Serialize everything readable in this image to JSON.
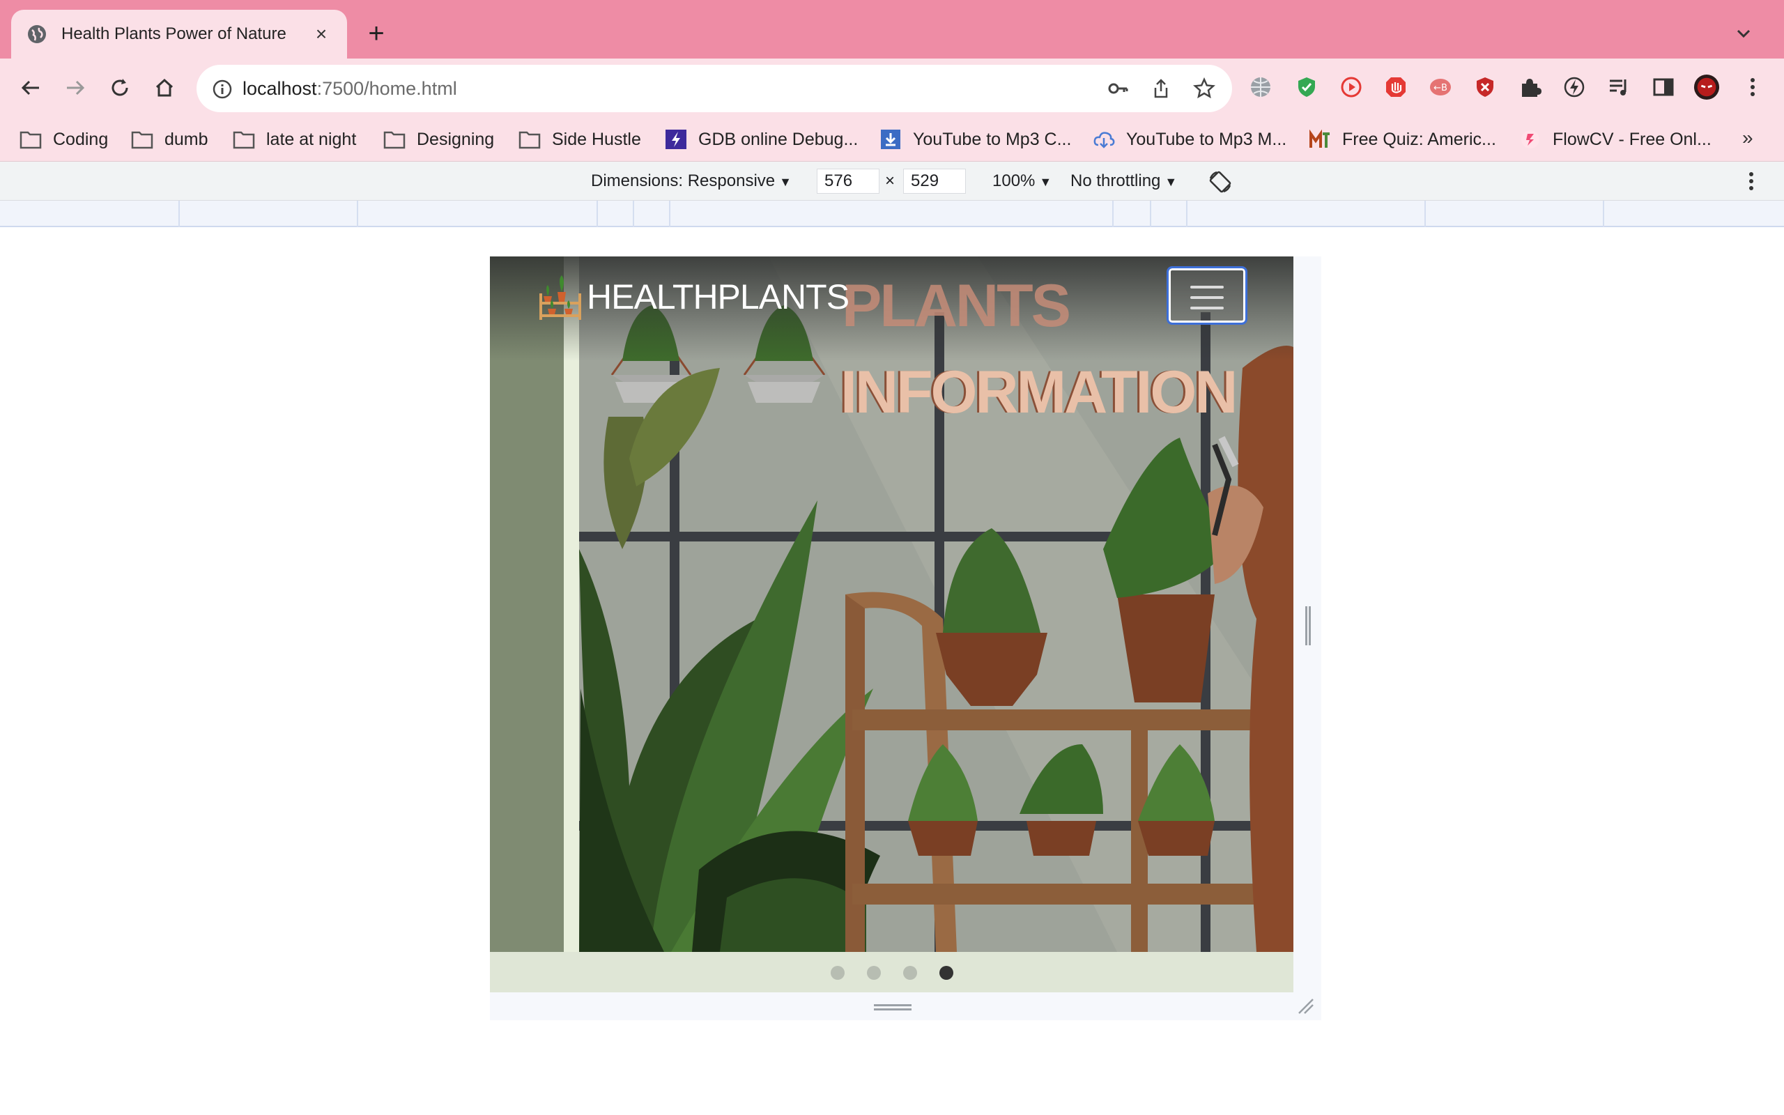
{
  "browser": {
    "tab": {
      "title": "Health Plants Power of Nature",
      "close_label": "×"
    },
    "new_tab_label": "+",
    "url": {
      "host": "localhost",
      "rest": ":7500/home.html"
    }
  },
  "bookmarks": [
    {
      "label": "Coding",
      "icon": "folder-icon"
    },
    {
      "label": "dumb",
      "icon": "folder-icon"
    },
    {
      "label": "late at night",
      "icon": "folder-icon"
    },
    {
      "label": "Designing",
      "icon": "folder-icon"
    },
    {
      "label": "Side Hustle",
      "icon": "folder-icon"
    },
    {
      "label": "GDB online Debug...",
      "icon": "gdb-icon"
    },
    {
      "label": "YouTube to Mp3 C...",
      "icon": "download-icon"
    },
    {
      "label": "YouTube to Mp3 M...",
      "icon": "cloud-download-icon"
    },
    {
      "label": "Free Quiz: Americ...",
      "icon": "quiz-icon"
    },
    {
      "label": "FlowCV - Free Onl...",
      "icon": "flowcv-icon"
    }
  ],
  "devtools": {
    "dimensions_label": "Dimensions: Responsive",
    "width": "576",
    "times": "×",
    "height": "529",
    "zoom": "100%",
    "throttling": "No throttling"
  },
  "page": {
    "brand": "HEALTHPLANTS",
    "hero_line1": "PLANTS",
    "hero_line2": "INFORMATION",
    "carousel_active_index": 3,
    "carousel_count": 4
  },
  "colors": {
    "tabstrip": "#ee8ca5",
    "toolbar": "#fbe0e7",
    "active_dot": "#333333",
    "focus_ring": "#3d6fd8"
  }
}
